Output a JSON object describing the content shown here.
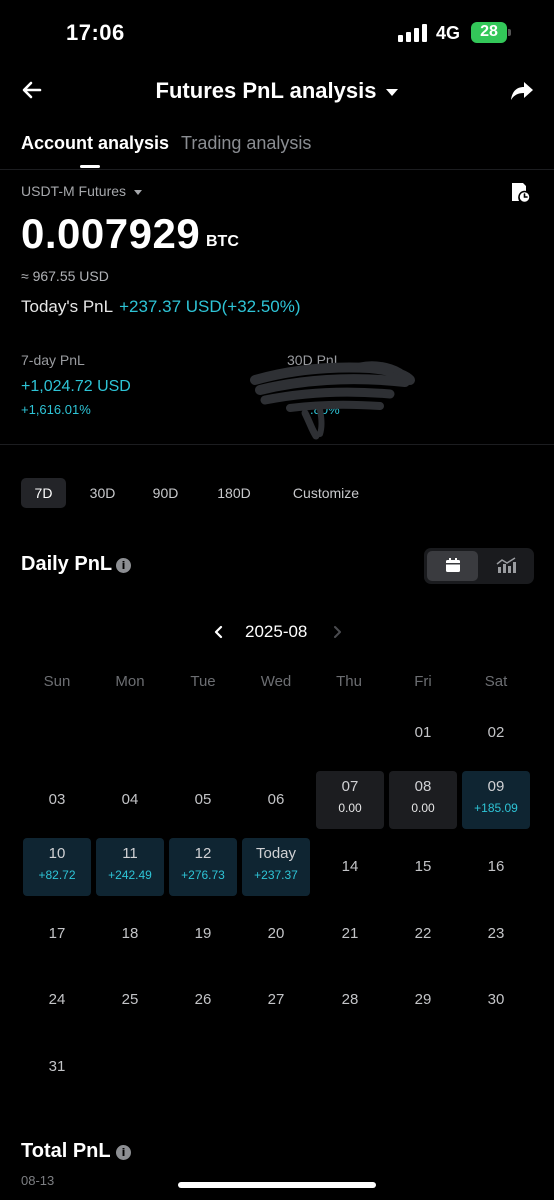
{
  "status_bar": {
    "time": "17:06",
    "network": "4G",
    "battery": "28"
  },
  "header": {
    "title": "Futures PnL analysis"
  },
  "tabs": [
    {
      "label": "Account analysis"
    },
    {
      "label": "Trading analysis"
    }
  ],
  "account": {
    "futures_type": "USDT-M Futures",
    "balance": "0.007929",
    "balance_unit": "BTC",
    "approx_usd": "≈ 967.55 USD",
    "today_pnl_label": "Today's PnL",
    "today_pnl_value": "+237.37 USD(+32.50%)"
  },
  "stats": {
    "seven_day_label": "7-day PnL",
    "seven_day_value": "+1,024.72 USD",
    "seven_day_pct": "+1,616.01%",
    "thirty_day_label": "30D PnL",
    "thirty_day_pct": ".80%"
  },
  "range_options": [
    "7D",
    "30D",
    "90D",
    "180D",
    "Customize"
  ],
  "daily_pnl": {
    "title": "Daily PnL",
    "month": "2025-08",
    "weekdays": [
      "Sun",
      "Mon",
      "Tue",
      "Wed",
      "Thu",
      "Fri",
      "Sat"
    ],
    "days": [
      {
        "label": "01",
        "value": ""
      },
      {
        "label": "02",
        "value": ""
      },
      {
        "label": "03",
        "value": ""
      },
      {
        "label": "04",
        "value": ""
      },
      {
        "label": "05",
        "value": ""
      },
      {
        "label": "06",
        "value": ""
      },
      {
        "label": "07",
        "value": "0.00"
      },
      {
        "label": "08",
        "value": "0.00"
      },
      {
        "label": "09",
        "value": "+185.09"
      },
      {
        "label": "10",
        "value": "+82.72"
      },
      {
        "label": "11",
        "value": "+242.49"
      },
      {
        "label": "12",
        "value": "+276.73"
      },
      {
        "label": "Today",
        "value": "+237.37"
      },
      {
        "label": "14",
        "value": ""
      },
      {
        "label": "15",
        "value": ""
      },
      {
        "label": "16",
        "value": ""
      },
      {
        "label": "17",
        "value": ""
      },
      {
        "label": "18",
        "value": ""
      },
      {
        "label": "19",
        "value": ""
      },
      {
        "label": "20",
        "value": ""
      },
      {
        "label": "21",
        "value": ""
      },
      {
        "label": "22",
        "value": ""
      },
      {
        "label": "23",
        "value": ""
      },
      {
        "label": "24",
        "value": ""
      },
      {
        "label": "25",
        "value": ""
      },
      {
        "label": "26",
        "value": ""
      },
      {
        "label": "27",
        "value": ""
      },
      {
        "label": "28",
        "value": ""
      },
      {
        "label": "29",
        "value": ""
      },
      {
        "label": "30",
        "value": ""
      },
      {
        "label": "31",
        "value": ""
      }
    ]
  },
  "total_pnl": {
    "title": "Total PnL",
    "date": "08-13"
  },
  "colors": {
    "positive": "#2ec4d6",
    "background": "#000000",
    "battery": "#33c759"
  },
  "icons": [
    "back-arrow-icon",
    "share-icon",
    "history-icon",
    "info-icon",
    "calendar-icon",
    "chart-icon",
    "chevron-left-icon",
    "chevron-right-icon"
  ]
}
